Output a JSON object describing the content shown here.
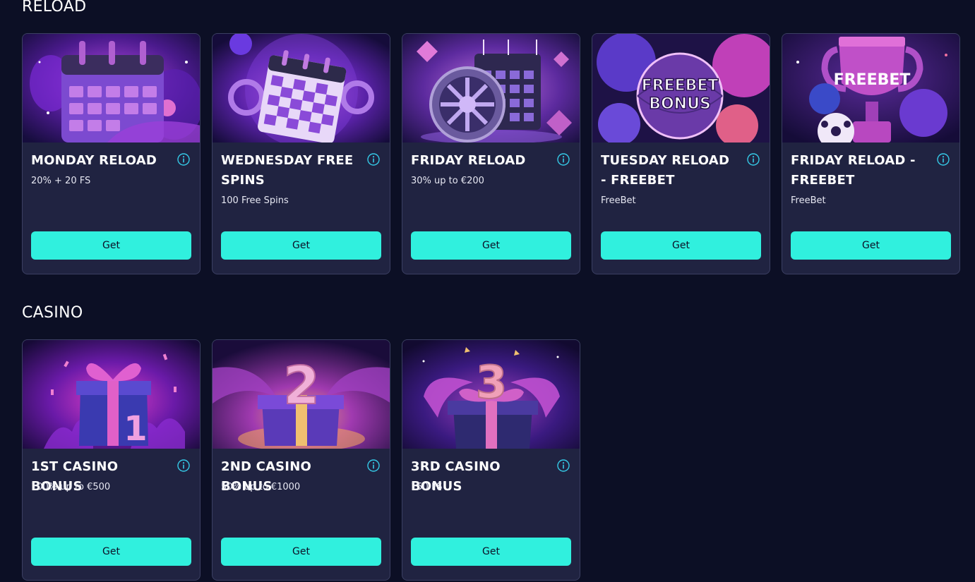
{
  "colors": {
    "background": "#0c0f25",
    "card": "#202341",
    "card_border": "#3b3f62",
    "button": "#30f0de",
    "button_text": "#0d1027",
    "info_icon": "#35c9e6"
  },
  "sections": {
    "reload": {
      "title": "RELOAD",
      "cards": [
        {
          "title": "MONDAY RELOAD",
          "subtitle": "20% + 20 FS",
          "button": "Get",
          "image": "calendar-illustration"
        },
        {
          "title": "WEDNESDAY FREE SPINS",
          "subtitle": "100 Free Spins",
          "button": "Get",
          "image": "checkered-calendar-illustration"
        },
        {
          "title": "FRIDAY RELOAD",
          "subtitle": "30% up to €200",
          "button": "Get",
          "image": "roulette-calendar-illustration"
        },
        {
          "title": "TUESDAY RELOAD - FREEBET",
          "subtitle": "FreeBet",
          "button": "Get",
          "image": "freebet-bonus-balls-illustration",
          "image_text": [
            "FREEBET",
            "BONUS"
          ]
        },
        {
          "title": "FRIDAY RELOAD - FREEBET",
          "subtitle": "FreeBet",
          "button": "Get",
          "image": "freebet-trophy-illustration",
          "image_text": [
            "FREEBET"
          ]
        }
      ]
    },
    "casino": {
      "title": "CASINO",
      "cards": [
        {
          "title": "1ST CASINO BONUS",
          "subtitle": "100% up to €500",
          "button": "Get",
          "image": "gift-box-1-illustration",
          "image_text": [
            "1"
          ]
        },
        {
          "title": "2ND CASINO BONUS",
          "subtitle": "50% up to €1000",
          "button": "Get",
          "image": "gift-box-2-illustration",
          "image_text": [
            "2"
          ]
        },
        {
          "title": "3RD CASINO BONUS",
          "subtitle": "150 FS",
          "button": "Get",
          "image": "gift-box-3-illustration",
          "image_text": [
            "3"
          ]
        }
      ]
    }
  }
}
